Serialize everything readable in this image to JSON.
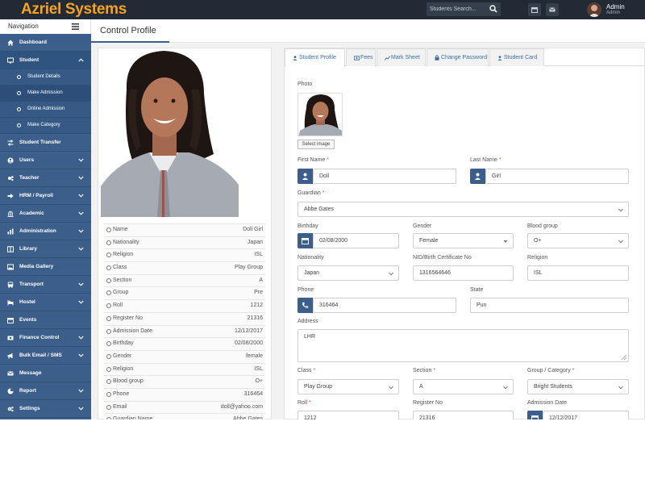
{
  "brand": "Azriel Systems",
  "topbar": {
    "search_placeholder": "Students Search...",
    "user_name": "Admin",
    "user_role": "Admin"
  },
  "sidebar": {
    "heading": "Navigation",
    "items": [
      {
        "key": "dashboard",
        "label": "Dashboard",
        "icon": "dashboard-icon",
        "has_children": false
      },
      {
        "key": "student",
        "label": "Student",
        "icon": "student-icon",
        "has_children": true,
        "expanded": true,
        "children": [
          "Student Details",
          "Make Admission",
          "Online Admission",
          "Make Category"
        ]
      },
      {
        "key": "student-transfer",
        "label": "Student Transfer",
        "icon": "transfer-icon",
        "has_children": false
      },
      {
        "key": "users",
        "label": "Users",
        "icon": "users-icon",
        "has_children": true
      },
      {
        "key": "teacher",
        "label": "Teacher",
        "icon": "teacher-icon",
        "has_children": true
      },
      {
        "key": "hrm-payroll",
        "label": "HRM / Payroll",
        "icon": "payroll-icon",
        "has_children": true
      },
      {
        "key": "academic",
        "label": "Academic",
        "icon": "academic-icon",
        "has_children": true
      },
      {
        "key": "administration",
        "label": "Administration",
        "icon": "chart-icon",
        "has_children": true
      },
      {
        "key": "library",
        "label": "Library",
        "icon": "library-icon",
        "has_children": true
      },
      {
        "key": "media-gallery",
        "label": "Media Gallery",
        "icon": "gallery-icon",
        "has_children": false
      },
      {
        "key": "transport",
        "label": "Transport",
        "icon": "bus-icon",
        "has_children": true
      },
      {
        "key": "hostel",
        "label": "Hostel",
        "icon": "hostel-icon",
        "has_children": true
      },
      {
        "key": "events",
        "label": "Events",
        "icon": "calendar-icon",
        "has_children": false
      },
      {
        "key": "finance-control",
        "label": "Finance Control",
        "icon": "finance-icon",
        "has_children": true
      },
      {
        "key": "bulk-email-sms",
        "label": "Bulk Email / SMS",
        "icon": "bullhorn-icon",
        "has_children": true
      },
      {
        "key": "message",
        "label": "Message",
        "icon": "envelope-icon",
        "has_children": false
      },
      {
        "key": "report",
        "label": "Report",
        "icon": "pie-icon",
        "has_children": true
      },
      {
        "key": "settings",
        "label": "Settings",
        "icon": "gears-icon",
        "has_children": true
      }
    ],
    "current_child": "Make Admission"
  },
  "page": {
    "title": "Control Profile"
  },
  "profile": {
    "rows": [
      {
        "label": "Name",
        "value": "Doll Girl"
      },
      {
        "label": "Nationality",
        "value": "Japan"
      },
      {
        "label": "Religion",
        "value": "ISL"
      },
      {
        "label": "Class",
        "value": "Play Group"
      },
      {
        "label": "Section",
        "value": "A"
      },
      {
        "label": "Group",
        "value": "Pre"
      },
      {
        "label": "Roll",
        "value": "1212"
      },
      {
        "label": "Register No",
        "value": "21316"
      },
      {
        "label": "Admission Date",
        "value": "12/12/2017"
      },
      {
        "label": "Birthday",
        "value": "02/08/2000"
      },
      {
        "label": "Gender",
        "value": "female"
      },
      {
        "label": "Religion",
        "value": "ISL"
      },
      {
        "label": "Blood group",
        "value": "O+"
      },
      {
        "label": "Phone",
        "value": "316464"
      },
      {
        "label": "Email",
        "value": "doll@yahoo.com"
      },
      {
        "label": "Guardian Name",
        "value": "Abbe Gates"
      }
    ]
  },
  "tabs": [
    {
      "label": "Student Profile",
      "active": true
    },
    {
      "label": "Fees",
      "active": false
    },
    {
      "label": "Mark Sheet",
      "active": false
    },
    {
      "label": "Change Password",
      "active": false
    },
    {
      "label": "Student Card",
      "active": false
    }
  ],
  "form": {
    "photo_label": "Photo",
    "select_image": "Select image",
    "first_name": {
      "label": "First Name",
      "value": "Doll"
    },
    "last_name": {
      "label": "Last Name",
      "value": "Girl"
    },
    "guardian": {
      "label": "Guardian",
      "value": "Abbe Gates"
    },
    "birthday": {
      "label": "Birthday",
      "value": "02/08/2000"
    },
    "gender": {
      "label": "Gender",
      "value": "Female"
    },
    "blood_group": {
      "label": "Blood group",
      "value": "O+"
    },
    "nationality": {
      "label": "Nationality",
      "value": "Japan"
    },
    "nid": {
      "label": "NID/Birth Certificate No",
      "value": "1316564646"
    },
    "religion": {
      "label": "Religion",
      "value": "ISL"
    },
    "phone": {
      "label": "Phone",
      "value": "316464"
    },
    "state": {
      "label": "State",
      "value": "Pun"
    },
    "address": {
      "label": "Address",
      "value": "LHR"
    },
    "class": {
      "label": "Class",
      "value": "Play Group"
    },
    "section": {
      "label": "Section",
      "value": "A"
    },
    "group_category": {
      "label": "Group / Category",
      "value": "Bright Students"
    },
    "roll": {
      "label": "Roll",
      "value": "1212"
    },
    "register_no": {
      "label": "Register No",
      "value": "21316"
    },
    "admission_date": {
      "label": "Admission Date",
      "value": "12/12/2017"
    }
  },
  "colors": {
    "topbar": "#222a35",
    "brand": "#f6a21d",
    "sidebar": "#3b5f8a",
    "tab_text": "#3b6ea5",
    "required": "#d9534f"
  }
}
